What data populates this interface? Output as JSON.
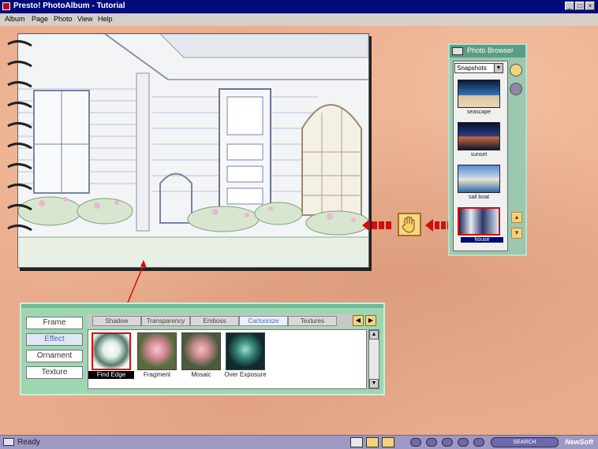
{
  "window": {
    "title": "Presto! PhotoAlbum - Tutorial",
    "controls": [
      "_",
      "□",
      "×"
    ]
  },
  "menu": [
    "Album",
    "Page",
    "Photo",
    "View",
    "Help"
  ],
  "photo_browser": {
    "title": "Photo Browser",
    "folder": "Snapshots",
    "thumbnails": [
      "seascape",
      "sunset",
      "sail boat",
      "house"
    ],
    "selected": "house"
  },
  "effects_panel": {
    "categories": [
      "Frame",
      "Effect",
      "Ornament",
      "Texture"
    ],
    "selected_category": "Effect",
    "tabs": [
      "Shadow",
      "Transparency",
      "Emboss",
      "Cartoonize",
      "Textures"
    ],
    "selected_tab": "Cartoonize",
    "effects": [
      "Find Edge",
      "Fragment",
      "Mosaic",
      "Over Exposure"
    ],
    "selected_effect": "Find Edge"
  },
  "status": {
    "text": "Ready",
    "brand": "NewSoft",
    "search_label": "SEARCH"
  },
  "colors": {
    "titlebar": "#000a7a",
    "background": "#e8ac8c",
    "panel": "#9ed6b2",
    "browser": "#9cc7b0",
    "statusbar": "#9d98c4",
    "arrow": "#d10f0f"
  }
}
